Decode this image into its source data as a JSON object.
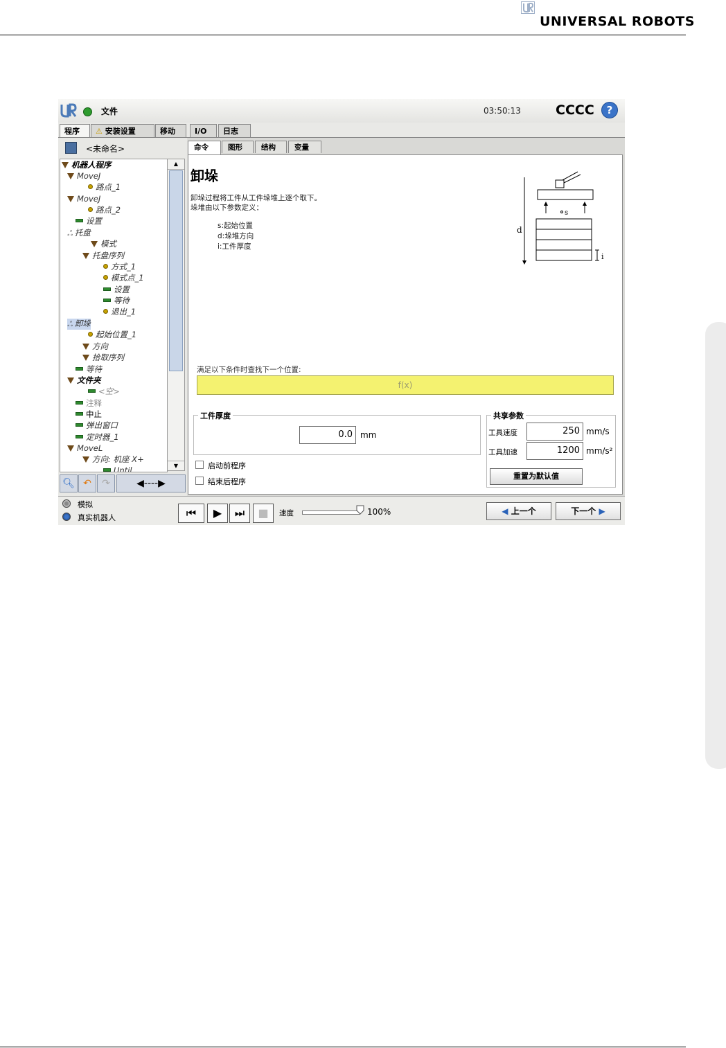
{
  "page": {
    "brand": "UNIVERSAL ROBOTS"
  },
  "titlebar": {
    "file_menu": "文件",
    "time": "03:50:13",
    "robot_name": "CCCC",
    "help": "?"
  },
  "main_tabs": [
    {
      "label": "程序",
      "active": true
    },
    {
      "label": "安装设置",
      "warning": true
    },
    {
      "label": "移动"
    },
    {
      "label": "I/O"
    },
    {
      "label": "日志"
    }
  ],
  "program": {
    "name": "<未命名>",
    "tree": [
      {
        "label": "机器人程序",
        "icon": "triangle",
        "bold": true,
        "italic": true
      },
      {
        "label": "MoveJ",
        "icon": "triangle",
        "italic": true
      },
      {
        "label": "路点_1",
        "icon": "waypoint",
        "italic": true
      },
      {
        "label": "MoveJ",
        "icon": "triangle",
        "italic": true
      },
      {
        "label": "路点_2",
        "icon": "waypoint",
        "italic": true
      },
      {
        "label": "设置",
        "icon": "bar",
        "italic": true
      },
      {
        "label": "托盘",
        "icon": "pallet",
        "italic": true
      },
      {
        "label": "模式",
        "icon": "triangle",
        "italic": true
      },
      {
        "label": "托盘序列",
        "icon": "triangle",
        "italic": true
      },
      {
        "label": "方式_1",
        "icon": "waypoint",
        "italic": true
      },
      {
        "label": "模式点_1",
        "icon": "waypoint",
        "italic": true
      },
      {
        "label": "设置",
        "icon": "bar",
        "italic": true
      },
      {
        "label": "等待",
        "icon": "bar",
        "italic": true
      },
      {
        "label": "退出_1",
        "icon": "waypoint",
        "italic": true
      },
      {
        "label": "卸垛",
        "icon": "pallet",
        "italic": true,
        "selected": true
      },
      {
        "label": "起始位置_1",
        "icon": "waypoint",
        "italic": true
      },
      {
        "label": "方向",
        "icon": "triangle",
        "italic": true
      },
      {
        "label": "拾取序列",
        "icon": "triangle",
        "italic": true
      },
      {
        "label": "等待",
        "icon": "bar",
        "italic": true
      },
      {
        "label": "文件夹",
        "icon": "triangle",
        "bold": true,
        "italic": true
      },
      {
        "label": "<空>",
        "icon": "bar",
        "italic": true,
        "dim": true
      },
      {
        "label": "注释",
        "icon": "bar",
        "dim": true
      },
      {
        "label": "中止",
        "icon": "bar"
      },
      {
        "label": "弹出窗口",
        "icon": "bar",
        "italic": true
      },
      {
        "label": "定时器_1",
        "icon": "bar",
        "italic": true
      },
      {
        "label": "MoveL",
        "icon": "triangle",
        "italic": true
      },
      {
        "label": "方向: 机座 X+",
        "icon": "triangle",
        "italic": true
      },
      {
        "label": "Until",
        "icon": "bar",
        "italic": true
      }
    ]
  },
  "sub_tabs": [
    {
      "label": "命令",
      "active": true
    },
    {
      "label": "图形"
    },
    {
      "label": "结构"
    },
    {
      "label": "变量"
    }
  ],
  "command": {
    "title": "卸垛",
    "desc_line1": "卸垛过程将工件从工件垛堆上逐个取下。",
    "desc_line2": "垛堆由以下参数定义：",
    "params": [
      "s:起始位置",
      "d:垛堆方向",
      "i:工件厚度"
    ],
    "diagram_labels": {
      "d": "d",
      "s": "s",
      "i": "i"
    },
    "condition_label": "满足以下条件时查找下一个位置:",
    "condition_expr": "f(x)",
    "thickness": {
      "label": "工件厚度",
      "value": "0.0",
      "unit": "mm"
    },
    "shared": {
      "label": "共享参数",
      "tool_speed_label": "工具速度",
      "tool_speed": "250",
      "tool_speed_unit": "mm/s",
      "tool_accel_label": "工具加速",
      "tool_accel": "1200",
      "tool_accel_unit": "mm/s²",
      "reset_label": "重置为默认值"
    },
    "start_program_label": "启动前程序",
    "end_program_label": "结束后程序"
  },
  "bottom": {
    "simulation_label": "模拟",
    "real_robot_label": "真实机器人",
    "speed_label": "速度",
    "speed_value": "100%",
    "speed_fraction": 1.0,
    "prev_label": "上一个",
    "next_label": "下一个"
  }
}
